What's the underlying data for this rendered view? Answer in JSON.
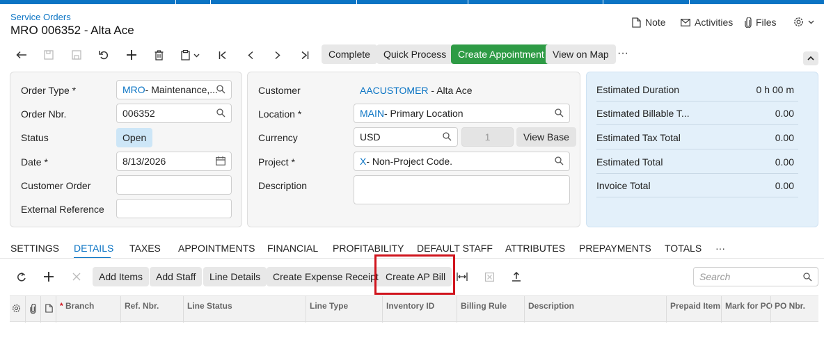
{
  "header": {
    "breadcrumb": "Service Orders",
    "title": "MRO 006352 - Alta Ace",
    "note_label": "Note",
    "activities_label": "Activities",
    "files_label": "Files"
  },
  "toolbar": {
    "complete": "Complete",
    "quick_process": "Quick Process",
    "create_appointment": "Create Appointment",
    "view_on_map": "View on Map",
    "more": "···"
  },
  "form": {
    "order_type_label": "Order Type",
    "order_type_code": "MRO",
    "order_type_desc": " - Maintenance,...",
    "order_nbr_label": "Order Nbr.",
    "order_nbr_value": "006352",
    "status_label": "Status",
    "status_value": "Open",
    "date_label": "Date",
    "date_value": "8/13/2026",
    "customer_order_label": "Customer Order",
    "customer_order_value": "",
    "external_reference_label": "External Reference",
    "external_reference_value": "",
    "required_mark": "*"
  },
  "customer": {
    "customer_label": "Customer",
    "customer_code": "AACUSTOMER",
    "customer_name": " - Alta Ace",
    "location_label": "Location",
    "location_code": "MAIN",
    "location_desc": " - Primary Location",
    "currency_label": "Currency",
    "currency_value": "USD",
    "rate_value": "1",
    "view_base_label": "View Base",
    "project_label": "Project",
    "project_code": "X",
    "project_desc": " - Non-Project Code.",
    "description_label": "Description",
    "description_value": ""
  },
  "summary": {
    "rows": [
      {
        "label": "Estimated Duration",
        "value": "0 h 00 m"
      },
      {
        "label": "Estimated Billable T...",
        "value": "0.00"
      },
      {
        "label": "Estimated Tax Total",
        "value": "0.00"
      },
      {
        "label": "Estimated Total",
        "value": "0.00"
      },
      {
        "label": "Invoice Total",
        "value": "0.00"
      }
    ]
  },
  "tabs": [
    "SETTINGS",
    "DETAILS",
    "TAXES",
    "APPOINTMENTS",
    "FINANCIAL",
    "PROFITABILITY",
    "DEFAULT STAFF",
    "ATTRIBUTES",
    "PREPAYMENTS",
    "TOTALS",
    "···"
  ],
  "grid_toolbar": {
    "add_items": "Add Items",
    "add_staff": "Add Staff",
    "line_details": "Line Details",
    "create_expense_receipt": "Create Expense Receipt",
    "create_ap_bill": "Create AP Bill",
    "search_placeholder": "Search"
  },
  "grid_columns": [
    "Branch",
    "Ref. Nbr.",
    "Line Status",
    "Line Type",
    "Inventory ID",
    "Billing Rule",
    "Description",
    "Prepaid Item",
    "Mark for PO",
    "PO Nbr."
  ],
  "colors": {
    "accent": "#0b74c4",
    "green": "#2e9b45",
    "highlight": "#d0141d"
  }
}
